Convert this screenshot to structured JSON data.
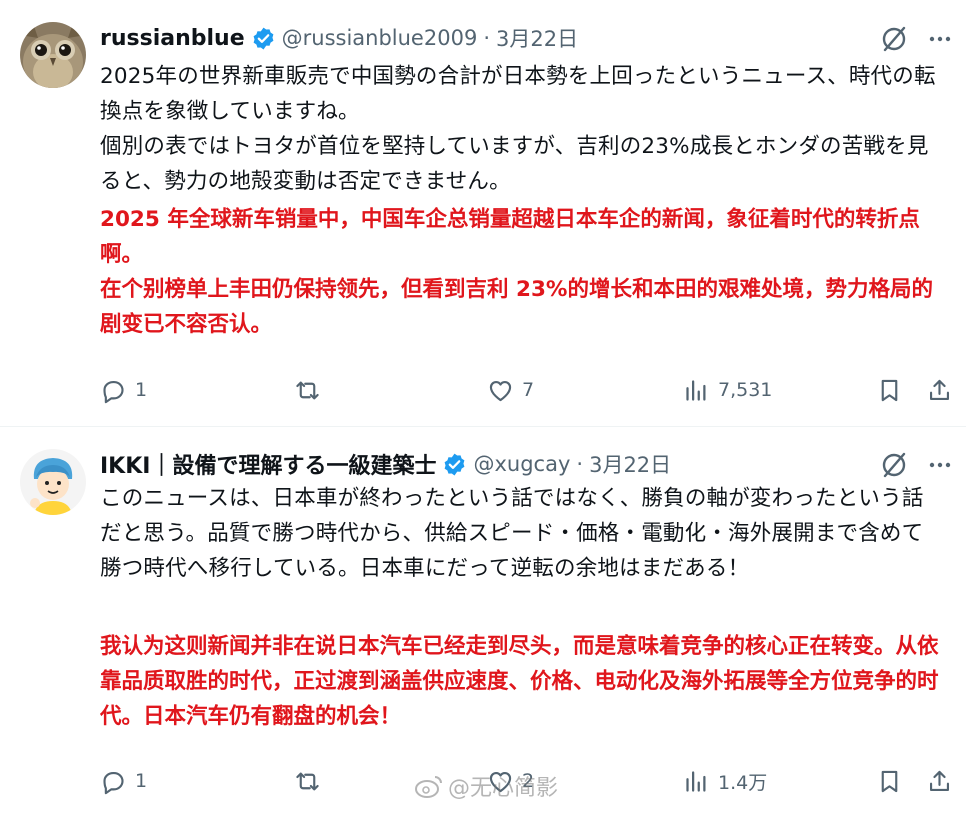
{
  "tweets": [
    {
      "name": "russianblue",
      "handle": "@russianblue2009",
      "date": "3月22日",
      "body_jp": [
        "2025年の世界新車販売で中国勢の合計が日本勢を上回ったというニュース、時代の転換点を象徴していますね。",
        "個別の表ではトヨタが首位を堅持していますが、吉利の23%成長とホンダの苦戦を見ると、勢力の地殻変動は否定できません。"
      ],
      "body_cn": [
        "2025 年全球新车销量中，中国车企总销量超越日本车企的新闻，象征着时代的转折点啊。",
        "在个别榜单上丰田仍保持领先，但看到吉利 23%的增长和本田的艰难处境，势力格局的剧变已不容否认。"
      ],
      "replies": "1",
      "retweets": "",
      "likes": "7",
      "views": "7,531"
    },
    {
      "name": "IKKI｜設備で理解する一級建築士",
      "handle": "@xugcay",
      "date": "3月22日",
      "body_jp": [
        "このニュースは、日本車が終わったという話ではなく、勝負の軸が変わったという話だと思う。品質で勝つ時代から、供給スピード・価格・電動化・海外展開まで含めて勝つ時代へ移行している。日本車にだって逆転の余地はまだある！"
      ],
      "body_cn": [
        "我认为这则新闻并非在说日本汽车已经走到尽头，而是意味着竞争的核心正在转变。从依靠品质取胜的时代，正过渡到涵盖供应速度、价格、电动化及海外拓展等全方位竞争的时代。日本汽车仍有翻盘的机会！"
      ],
      "replies": "1",
      "retweets": "",
      "likes": "2",
      "views": "1.4万"
    }
  ],
  "watermark": "@无心简影",
  "colors": {
    "verified": "#1d9bf0",
    "translation_red": "#e0161c",
    "muted": "#536471"
  }
}
